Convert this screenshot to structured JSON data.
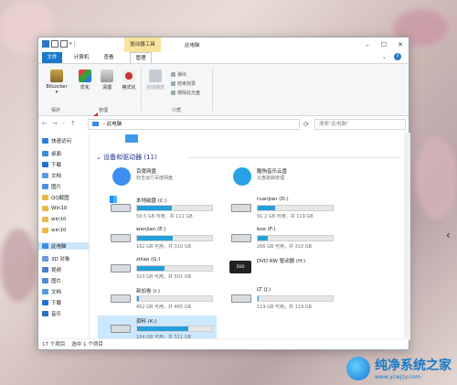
{
  "window": {
    "title": "此电脑",
    "context_tab": "驱动器工具"
  },
  "ribbon_tabs": [
    "文件",
    "计算机",
    "查看",
    "管理"
  ],
  "ribbon": {
    "bitlocker": "BitLocker",
    "optimize": "优化",
    "cleanup": "清理",
    "format": "格式化",
    "autoplay": "自动播放",
    "eject": "弹出",
    "finish_burn": "结束刻录",
    "erase_disc": "擦除此光盘",
    "group_protect": "保护",
    "group_manage": "管理",
    "group_media": "介质"
  },
  "address": {
    "path": "此电脑",
    "search_placeholder": "搜索\"此电脑\""
  },
  "sidebar": {
    "items": [
      {
        "label": "快速访问",
        "icon": "star-icon",
        "color": "#2f7ed8"
      },
      {
        "label": "桌面",
        "icon": "desktop-icon",
        "color": "#3b8be0"
      },
      {
        "label": "下载",
        "icon": "download-icon",
        "color": "#1f6fd1"
      },
      {
        "label": "文档",
        "icon": "document-icon",
        "color": "#5a9be0"
      },
      {
        "label": "图片",
        "icon": "pictures-icon",
        "color": "#4a90d9"
      },
      {
        "label": "QQ截图",
        "icon": "folder-icon",
        "color": "#e8b84a"
      },
      {
        "label": "Win10",
        "icon": "folder-icon",
        "color": "#e8b84a"
      },
      {
        "label": "win10",
        "icon": "folder-icon",
        "color": "#e8b84a"
      },
      {
        "label": "win10",
        "icon": "folder-icon",
        "color": "#e8b84a"
      },
      {
        "label": "此电脑",
        "icon": "computer-icon",
        "color": "#3b8be0"
      },
      {
        "label": "3D 对象",
        "icon": "cube-icon",
        "color": "#6a9bd8"
      },
      {
        "label": "视频",
        "icon": "video-icon",
        "color": "#4c7fc9"
      },
      {
        "label": "图片",
        "icon": "pictures-icon",
        "color": "#4a90d9"
      },
      {
        "label": "文档",
        "icon": "document-icon",
        "color": "#5a9be0"
      },
      {
        "label": "下载",
        "icon": "download-icon",
        "color": "#1f6fd1"
      },
      {
        "label": "音乐",
        "icon": "music-icon",
        "color": "#2d6fc2"
      }
    ]
  },
  "section": {
    "title": "设备和驱动器 (11)"
  },
  "apps": [
    {
      "name": "百度网盘",
      "subtitle": "双击运行百度网盘",
      "color": "#3c8ef3"
    },
    {
      "name": "酷狗音乐云盘",
      "subtitle": "云盘歌曲管理",
      "color": "#2aa1e6"
    }
  ],
  "drives": [
    {
      "name": "本地磁盘 (C:)",
      "free": "59.5 GB 可用，共 111 GB",
      "used": 0.46
    },
    {
      "name": "ruanjian (D:)",
      "free": "91.2 GB 可用，共 119 GB",
      "used": 0.23
    },
    {
      "name": "wenjian (E:)",
      "free": "162 GB 可用，共 310 GB",
      "used": 0.48
    },
    {
      "name": "box (F:)",
      "free": "266 GB 可用，共 310 GB",
      "used": 0.14
    },
    {
      "name": "ziliao (G:)",
      "free": "320 GB 可用，共 501 GB",
      "used": 0.36
    },
    {
      "name": "DVD RW 驱动器 (H:)",
      "free": "",
      "used": 0
    },
    {
      "name": "新加卷 (I:)",
      "free": "452 GB 可用，共 465 GB",
      "used": 0.03
    },
    {
      "name": "LT (J:)",
      "free": "119 GB 可用，共 119 GB",
      "used": 0.01
    },
    {
      "name": "资料 (K:)",
      "free": "164 GB 可用，共 511 GB",
      "used": 0.68
    }
  ],
  "status": {
    "count": "17 个项目",
    "selected": "选中 1 个项目"
  },
  "watermark": {
    "title": "纯净系统之家",
    "url": "www.ycwjzy.com"
  }
}
